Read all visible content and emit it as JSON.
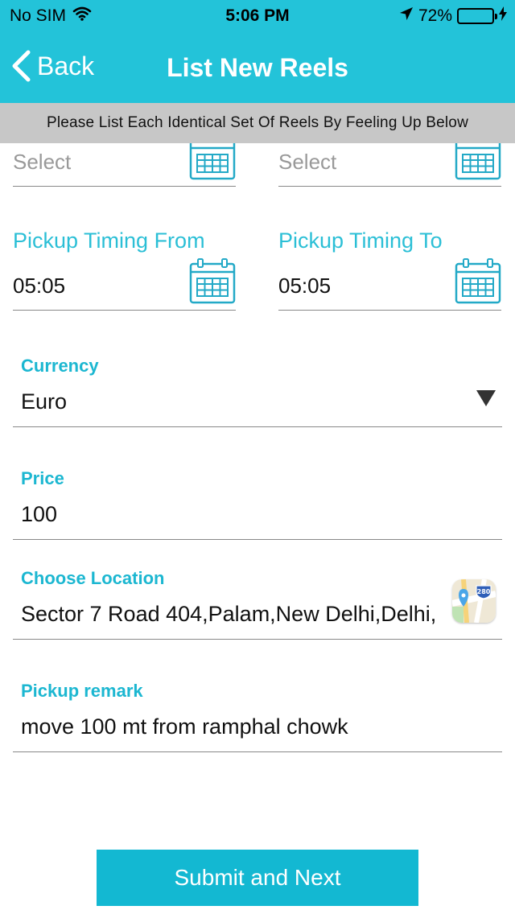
{
  "status_bar": {
    "carrier": "No SIM",
    "time": "5:06 PM",
    "battery_percent": "72%",
    "battery_level": 0.72,
    "battery_color": "#46d35c"
  },
  "nav": {
    "back_label": "Back",
    "title": "List New Reels"
  },
  "banner": "Please List Each Identical Set Of Reels By Feeling Up Below",
  "date_row": {
    "left_placeholder": "Select",
    "right_placeholder": "Select"
  },
  "pickup_timing": {
    "from_label": "Pickup Timing From",
    "from_value": "05:05",
    "to_label": "Pickup Timing To",
    "to_value": "05:05"
  },
  "currency": {
    "label": "Currency",
    "value": "Euro"
  },
  "price": {
    "label": "Price",
    "value": "100"
  },
  "location": {
    "label": "Choose Location",
    "value": "Sector 7 Road 404,Palam,New Delhi,Delhi,",
    "map_badge": "280"
  },
  "remark": {
    "label": "Pickup remark",
    "value": "move 100 mt from ramphal chowk"
  },
  "submit_label": "Submit and Next",
  "colors": {
    "accent": "#23c3d9",
    "label": "#1cb7d1",
    "button": "#13b8d2",
    "banner_bg": "#c7c7c7"
  }
}
